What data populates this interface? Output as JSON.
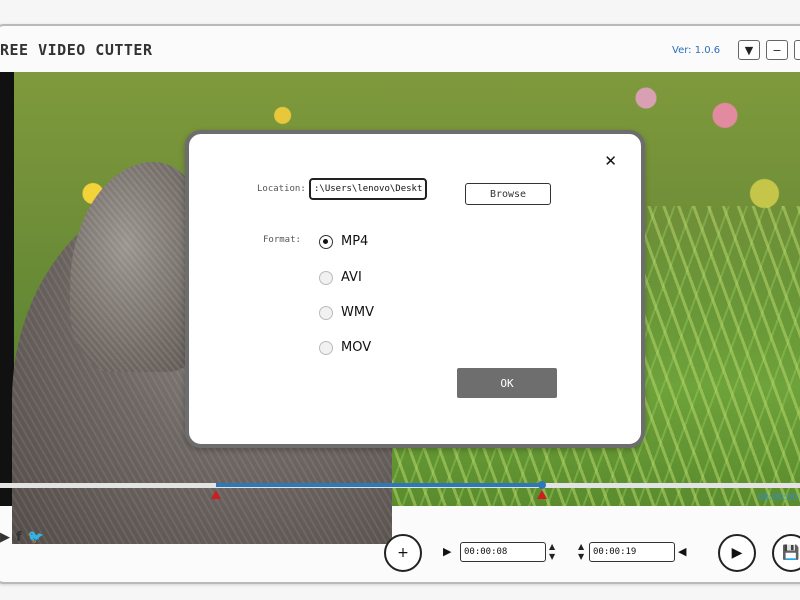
{
  "app": {
    "title": "REE VIDEO CUTTER",
    "version": "Ver: 1.0.6",
    "window_controls": {
      "menu": "▼",
      "minimize": "−",
      "close": "✕"
    }
  },
  "video": {
    "overlay_time": "00:00:00"
  },
  "dialog": {
    "close": "✕",
    "location_label": "Location:",
    "location_value": ":\\Users\\lenovo\\Desktop",
    "browse_label": "Browse",
    "format_label": "Format:",
    "formats": [
      {
        "label": "MP4",
        "checked": true
      },
      {
        "label": "AVI",
        "checked": false
      },
      {
        "label": "WMV",
        "checked": false
      },
      {
        "label": "MOV",
        "checked": false
      }
    ],
    "ok_label": "OK"
  },
  "controls": {
    "start_time": "00:00:08",
    "end_time": "00:00:19",
    "spinner_up": "▲",
    "spinner_down": "▼",
    "play_left": "▶",
    "play_right": "◀",
    "add_clip_icon": "+",
    "preview_icon": "▶",
    "save_icon": "💾",
    "social": {
      "youtube": "▶",
      "facebook": "f",
      "twitter": "🐦"
    },
    "colors": {
      "progress": "#2e78b6",
      "markers": "#cc1f1f"
    }
  }
}
